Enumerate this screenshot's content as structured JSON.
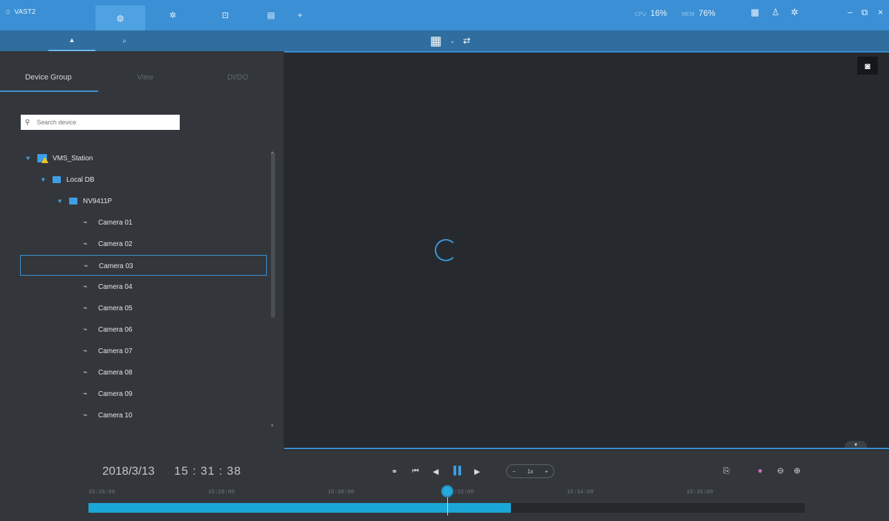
{
  "app": {
    "title": "VAST2"
  },
  "topbar": {
    "tabs": [
      {
        "name": "liveview-tab",
        "glyph": "◍"
      },
      {
        "name": "playback-tab",
        "glyph": "✲"
      },
      {
        "name": "alarm-tab",
        "glyph": "⊡"
      },
      {
        "name": "report-tab",
        "glyph": "▤"
      },
      {
        "name": "add-tab",
        "glyph": "+"
      }
    ],
    "cpu_label": "CPU",
    "cpu_value": "16%",
    "mem_label": "MEM",
    "mem_value": "76%"
  },
  "subbar": {
    "tabs": [
      {
        "glyph": "▲"
      },
      {
        "glyph": "⌕"
      }
    ]
  },
  "left_panel": {
    "tabs": [
      "Device Group",
      "View",
      "DI/DO"
    ],
    "search_value": "",
    "search_placeholder": "Search device",
    "tree": {
      "station": "VMS_Station",
      "localdb": "Local DB",
      "nvr": "NV9411P",
      "cameras": [
        "Camera 01",
        "Camera 02",
        "Camera 03",
        "Camera 04",
        "Camera 05",
        "Camera 06",
        "Camera 07",
        "Camera 08",
        "Camera 09",
        "Camera 10"
      ],
      "selected_camera_index": 2
    }
  },
  "playback": {
    "date": "2018/3/13",
    "time": "15 : 31 : 38",
    "speed_label": "1x",
    "timeline_ticks": [
      "15:26:00",
      "15:28:00",
      "15:30:00",
      "15:32:00",
      "15:34:00",
      "15:36:00"
    ],
    "recorded_fraction": 0.59,
    "cursor_fraction": 0.5
  },
  "colors": {
    "accent": "#3b8fd4",
    "timeline_fill": "#1aa7d8",
    "warning": "#f5c518"
  }
}
